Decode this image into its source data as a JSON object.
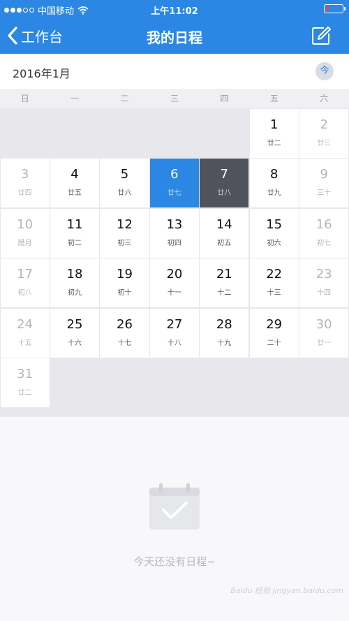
{
  "status_bar": {
    "carrier": "中国移动",
    "time": "上午11:02",
    "battery_level": 0.1
  },
  "nav": {
    "back_label": "工作台",
    "title": "我的日程",
    "back_icon": "chevron-left-icon",
    "compose_icon": "edit-icon"
  },
  "calendar": {
    "month_label": "2016年1月",
    "today_label": "今",
    "weekdays": [
      "日",
      "一",
      "二",
      "三",
      "四",
      "五",
      "六"
    ],
    "days": [
      {
        "day": "1",
        "lunar": "廿二",
        "weekday": 5
      },
      {
        "day": "2",
        "lunar": "廿三",
        "weekday": 6
      },
      {
        "day": "3",
        "lunar": "廿四",
        "weekday": 0
      },
      {
        "day": "4",
        "lunar": "廿五",
        "weekday": 1
      },
      {
        "day": "5",
        "lunar": "廿六",
        "weekday": 2
      },
      {
        "day": "6",
        "lunar": "廿七",
        "weekday": 3,
        "state": "selected"
      },
      {
        "day": "7",
        "lunar": "廿八",
        "weekday": 4,
        "state": "today"
      },
      {
        "day": "8",
        "lunar": "廿九",
        "weekday": 5
      },
      {
        "day": "9",
        "lunar": "三十",
        "weekday": 6
      },
      {
        "day": "10",
        "lunar": "腊月",
        "weekday": 0
      },
      {
        "day": "11",
        "lunar": "初二",
        "weekday": 1
      },
      {
        "day": "12",
        "lunar": "初三",
        "weekday": 2
      },
      {
        "day": "13",
        "lunar": "初四",
        "weekday": 3
      },
      {
        "day": "14",
        "lunar": "初五",
        "weekday": 4
      },
      {
        "day": "15",
        "lunar": "初六",
        "weekday": 5
      },
      {
        "day": "16",
        "lunar": "初七",
        "weekday": 6
      },
      {
        "day": "17",
        "lunar": "初八",
        "weekday": 0
      },
      {
        "day": "18",
        "lunar": "初九",
        "weekday": 1
      },
      {
        "day": "19",
        "lunar": "初十",
        "weekday": 2
      },
      {
        "day": "20",
        "lunar": "十一",
        "weekday": 3
      },
      {
        "day": "21",
        "lunar": "十二",
        "weekday": 4
      },
      {
        "day": "22",
        "lunar": "十三",
        "weekday": 5
      },
      {
        "day": "23",
        "lunar": "十四",
        "weekday": 6
      },
      {
        "day": "24",
        "lunar": "十五",
        "weekday": 0
      },
      {
        "day": "25",
        "lunar": "十六",
        "weekday": 1
      },
      {
        "day": "26",
        "lunar": "十七",
        "weekday": 2
      },
      {
        "day": "27",
        "lunar": "十八",
        "weekday": 3
      },
      {
        "day": "28",
        "lunar": "十九",
        "weekday": 4
      },
      {
        "day": "29",
        "lunar": "二十",
        "weekday": 5
      },
      {
        "day": "30",
        "lunar": "廿一",
        "weekday": 6
      },
      {
        "day": "31",
        "lunar": "廿二",
        "weekday": 0
      }
    ]
  },
  "empty_state": {
    "icon": "calendar-check-icon",
    "message": "今天还没有日程~"
  },
  "watermark": "Baidu 经验 jingyan.baidu.com",
  "colors": {
    "accent": "#2b87e3",
    "today": "#50525c",
    "weekend_text": "#b5b5b5"
  }
}
